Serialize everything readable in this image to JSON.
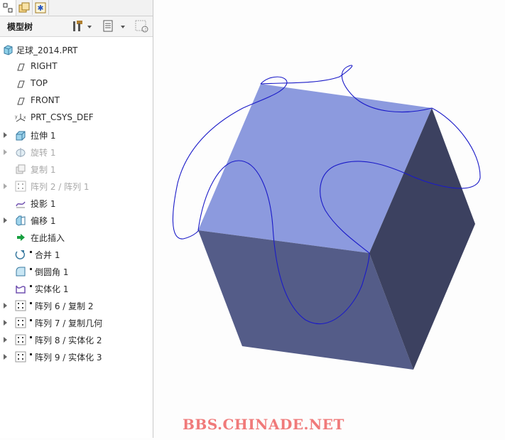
{
  "panel": {
    "title": "模型树",
    "tabs": [
      "model-tree",
      "layers",
      "favorites"
    ],
    "header_icons": [
      "tools-icon",
      "settings-icon",
      "show-icon"
    ]
  },
  "tree": {
    "root": "足球_2014.PRT",
    "items": [
      {
        "label": "RIGHT",
        "icon": "datum-plane-icon"
      },
      {
        "label": "TOP",
        "icon": "datum-plane-icon"
      },
      {
        "label": "FRONT",
        "icon": "datum-plane-icon"
      },
      {
        "label": "PRT_CSYS_DEF",
        "icon": "csys-icon"
      },
      {
        "label": "拉伸 1",
        "icon": "extrude-icon"
      },
      {
        "label": "旋转 1",
        "icon": "revolve-icon"
      },
      {
        "label": "复制 1",
        "icon": "copy-icon"
      },
      {
        "label": "阵列 2 / 阵列 1",
        "icon": "pattern-icon"
      },
      {
        "label": "投影 1",
        "icon": "projection-icon"
      },
      {
        "label": "偏移 1",
        "icon": "offset-icon"
      },
      {
        "label": "在此插入",
        "icon": "insert-here-icon"
      },
      {
        "label": "合并 1",
        "icon": "merge-icon"
      },
      {
        "label": "倒圆角 1",
        "icon": "round-icon"
      },
      {
        "label": "实体化 1",
        "icon": "solidify-icon"
      },
      {
        "label": "阵列 6 / 复制 2",
        "icon": "pattern-icon"
      },
      {
        "label": "阵列 7 / 复制几何",
        "icon": "pattern-icon"
      },
      {
        "label": "阵列 8 / 实体化 2",
        "icon": "pattern-icon"
      },
      {
        "label": "阵列 9 / 实体化 3",
        "icon": "pattern-icon"
      }
    ]
  },
  "viewport": {
    "colors": {
      "top_face": "#8c9ade",
      "left_face": "#545c88",
      "right_face": "#3c4160",
      "curve": "#1a1ac8"
    }
  },
  "watermark": "BBS.CHINADE.NET"
}
